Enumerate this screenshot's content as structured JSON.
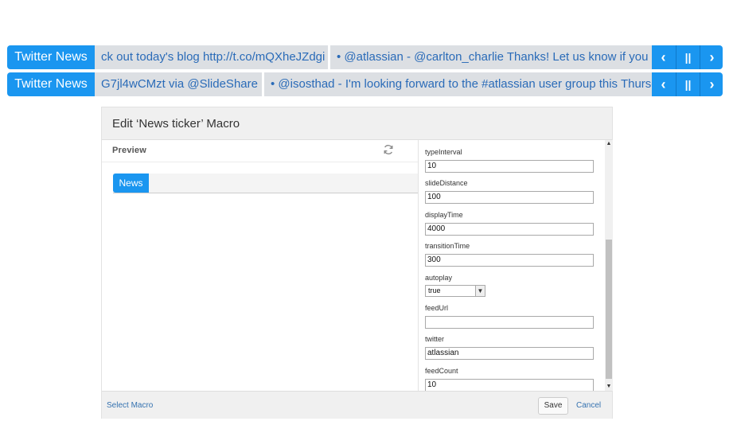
{
  "tickers": [
    {
      "label": "Twitter News",
      "items": [
        "ck out today's blog http://t.co/mQXheJZdgi",
        "• @atlassian - @carlton_charlie Thanks! Let us know if you ne"
      ]
    },
    {
      "label": "Twitter News",
      "items": [
        "G7jl4wCMzt via @SlideShare",
        "• @isosthad - I'm looking forward to the #atlassian user group this Thursday"
      ]
    }
  ],
  "ticker_controls": {
    "prev_icon": "‹",
    "pause_icon": "||",
    "next_icon": "›"
  },
  "dialog": {
    "title": "Edit ‘News ticker’ Macro",
    "preview_title": "Preview",
    "preview_ticker_label": "News",
    "params": {
      "typeInterval": {
        "label": "typeInterval",
        "value": "10"
      },
      "slideDistance": {
        "label": "slideDistance",
        "value": "100"
      },
      "displayTime": {
        "label": "displayTime",
        "value": "4000"
      },
      "transitionTime": {
        "label": "transitionTime",
        "value": "300"
      },
      "autoplay": {
        "label": "autoplay",
        "value": "true"
      },
      "feedUrl": {
        "label": "feedUrl",
        "value": ""
      },
      "twitter": {
        "label": "twitter",
        "value": "atlassian"
      },
      "feedCount": {
        "label": "feedCount",
        "value": "10"
      }
    },
    "footer": {
      "select_macro": "Select Macro",
      "save": "Save",
      "cancel": "Cancel"
    }
  },
  "colors": {
    "ticker_blue": "#1a96f0",
    "ticker_track": "#dfe1e5",
    "ticker_text": "#2a6bb8",
    "link": "#3572b0"
  }
}
